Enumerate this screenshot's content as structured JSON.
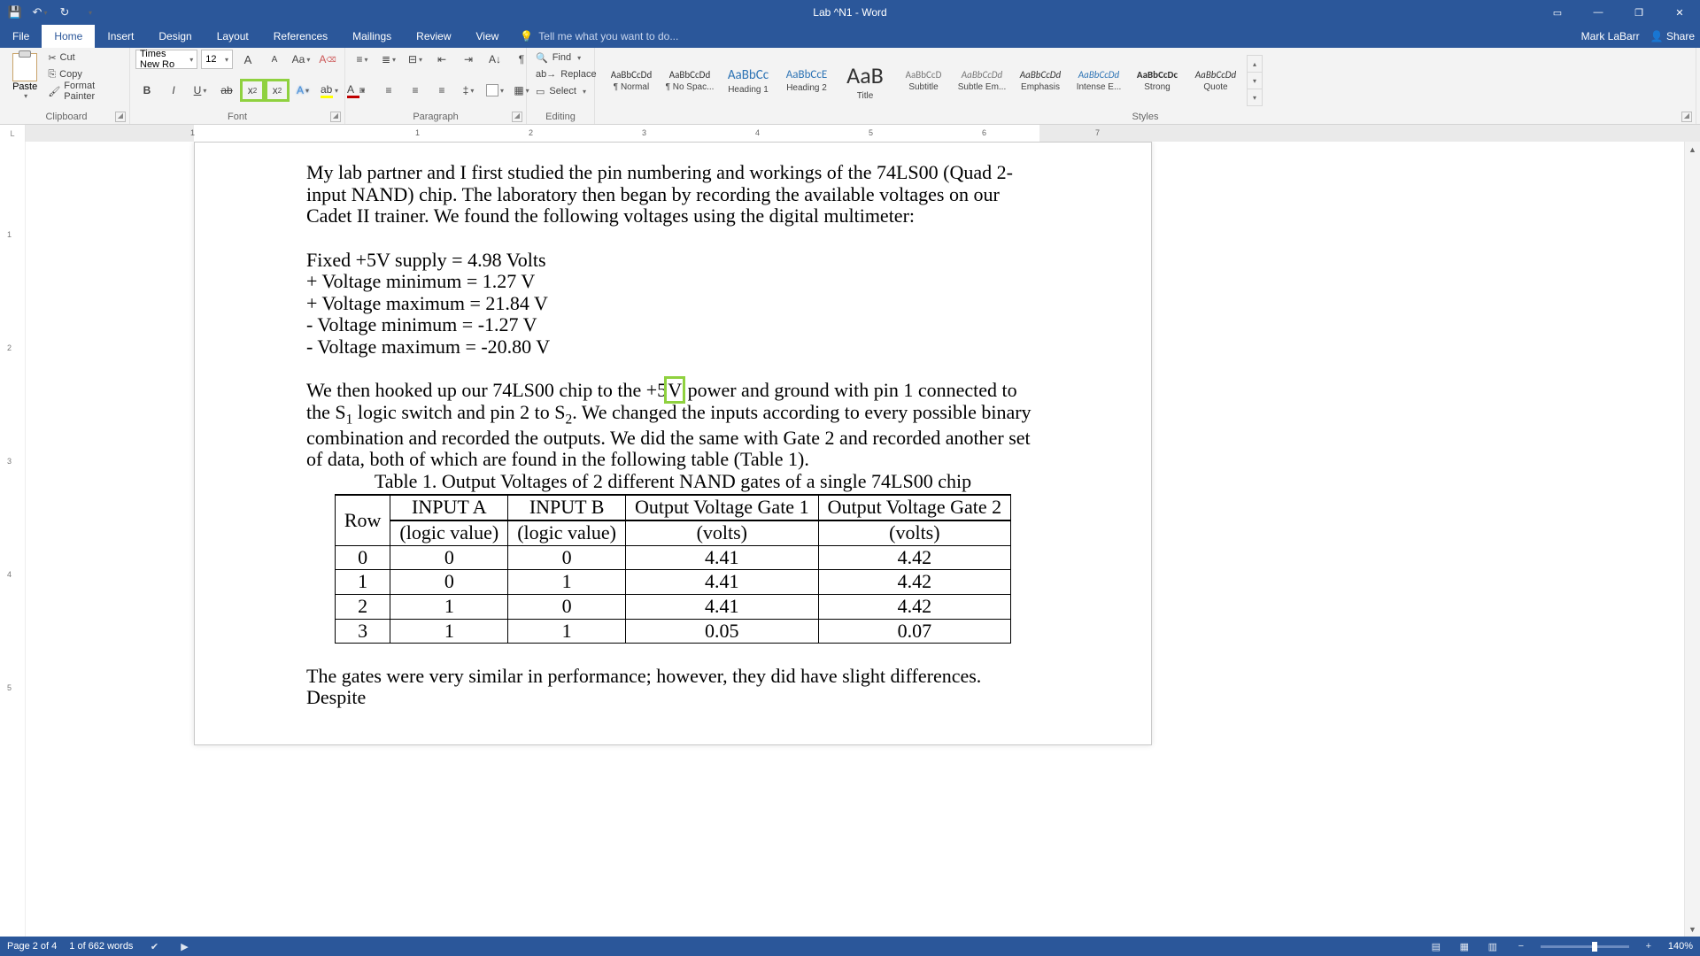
{
  "window": {
    "title": "Lab ^N1 - Word",
    "user": "Mark LaBarr",
    "share": "Share"
  },
  "qat": [
    "save",
    "undo",
    "redo",
    "customize"
  ],
  "tabs": [
    "File",
    "Home",
    "Insert",
    "Design",
    "Layout",
    "References",
    "Mailings",
    "Review",
    "View"
  ],
  "active_tab": "Home",
  "tellme": "Tell me what you want to do...",
  "ribbon": {
    "clipboard": {
      "label": "Clipboard",
      "paste": "Paste",
      "cut": "Cut",
      "copy": "Copy",
      "fmt": "Format Painter"
    },
    "font": {
      "label": "Font",
      "name": "Times New Ro",
      "size": "12"
    },
    "paragraph": {
      "label": "Paragraph"
    },
    "editing": {
      "label": "Editing",
      "find": "Find",
      "replace": "Replace",
      "select": "Select"
    },
    "styles": {
      "label": "Styles",
      "items": [
        {
          "preview": "AaBbCcDd",
          "name": "¶ Normal",
          "size": 11,
          "color": "#333"
        },
        {
          "preview": "AaBbCcDd",
          "name": "¶ No Spac...",
          "size": 11,
          "color": "#333"
        },
        {
          "preview": "AaBbCc",
          "name": "Heading 1",
          "size": 15,
          "color": "#2e74b5"
        },
        {
          "preview": "AaBbCcE",
          "name": "Heading 2",
          "size": 13,
          "color": "#2e74b5"
        },
        {
          "preview": "AaB",
          "name": "Title",
          "size": 26,
          "color": "#333"
        },
        {
          "preview": "AaBbCcD",
          "name": "Subtitle",
          "size": 11,
          "color": "#777"
        },
        {
          "preview": "AaBbCcDd",
          "name": "Subtle Em...",
          "size": 11,
          "color": "#777",
          "italic": true
        },
        {
          "preview": "AaBbCcDd",
          "name": "Emphasis",
          "size": 11,
          "color": "#333",
          "italic": true
        },
        {
          "preview": "AaBbCcDd",
          "name": "Intense E...",
          "size": 11,
          "color": "#2e74b5",
          "italic": true
        },
        {
          "preview": "AaBbCcDc",
          "name": "Strong",
          "size": 11,
          "color": "#333",
          "bold": true
        },
        {
          "preview": "AaBbCcDd",
          "name": "Quote",
          "size": 11,
          "color": "#333",
          "italic": true
        }
      ]
    }
  },
  "document": {
    "para1": "My lab partner and I first studied the pin numbering and workings of the 74LS00 (Quad 2-input NAND) chip. The laboratory then began by recording the available voltages on our Cadet II trainer. We found the following voltages using the digital multimeter:",
    "lines": [
      "Fixed +5V supply = 4.98 Volts",
      "+ Voltage minimum = 1.27 V",
      "+ Voltage maximum = 21.84 V",
      "- Voltage minimum = -1.27 V",
      "- Voltage maximum = -20.80 V"
    ],
    "para2_a": "We then hooked up our 74LS00 chip to the +5",
    "para2_v": "V",
    "para2_b": " power and ground with pin 1 connected to the S",
    "para2_c": " logic switch and pin 2 to S",
    "para2_d": ". We changed the inputs according to every possible binary combination and recorded the outputs. We did the same with Gate 2 and recorded another set of data, both of which are found in the following table (Table 1).",
    "table_caption": "Table 1. Output Voltages of 2 different NAND gates of a single 74LS00 chip",
    "headers": {
      "row": "Row",
      "a1": "INPUT A",
      "a2": "(logic value)",
      "b1": "INPUT B",
      "b2": "(logic value)",
      "g1a": "Output Voltage Gate 1",
      "g1b": "(volts)",
      "g2a": "Output Voltage Gate 2",
      "g2b": "(volts)"
    },
    "rows": [
      {
        "r": "0",
        "a": "0",
        "b": "0",
        "g1": "4.41",
        "g2": "4.42"
      },
      {
        "r": "1",
        "a": "0",
        "b": "1",
        "g1": "4.41",
        "g2": "4.42"
      },
      {
        "r": "2",
        "a": "1",
        "b": "0",
        "g1": "4.41",
        "g2": "4.42"
      },
      {
        "r": "3",
        "a": "1",
        "b": "1",
        "g1": "0.05",
        "g2": "0.07"
      }
    ],
    "para3": "The gates were very similar in performance; however, they did have slight differences. Despite"
  },
  "status": {
    "page": "Page 2 of 4",
    "words": "1 of 662 words",
    "zoom": "140%"
  },
  "chart_data": {
    "type": "table",
    "title": "Table 1. Output Voltages of 2 different NAND gates of a single 74LS00 chip",
    "columns": [
      "Row",
      "INPUT A (logic value)",
      "INPUT B (logic value)",
      "Output Voltage Gate 1 (volts)",
      "Output Voltage Gate 2 (volts)"
    ],
    "data": [
      [
        0,
        0,
        0,
        4.41,
        4.42
      ],
      [
        1,
        0,
        1,
        4.41,
        4.42
      ],
      [
        2,
        1,
        0,
        4.41,
        4.42
      ],
      [
        3,
        1,
        1,
        0.05,
        0.07
      ]
    ]
  }
}
